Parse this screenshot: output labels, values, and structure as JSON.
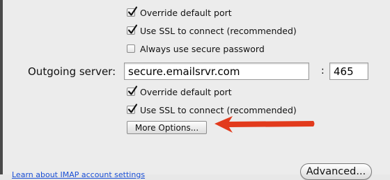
{
  "incoming": {
    "override_default_port": {
      "label": "Override default port",
      "checked": true
    },
    "use_ssl": {
      "label": "Use SSL to connect (recommended)",
      "checked": true
    },
    "secure_password": {
      "label": "Always use secure password",
      "checked": false
    }
  },
  "outgoing": {
    "server_label": "Outgoing server:",
    "server_value": "secure.emailsrvr.com",
    "colon": ":",
    "port_value": "465",
    "override_default_port": {
      "label": "Override default port",
      "checked": true
    },
    "use_ssl": {
      "label": "Use SSL to connect (recommended)",
      "checked": true
    },
    "more_options_label": "More Options..."
  },
  "footer": {
    "help_link": "Learn about IMAP account settings",
    "advanced_label": "Advanced..."
  },
  "annotation": {
    "arrow_color": "#e23a1c"
  }
}
